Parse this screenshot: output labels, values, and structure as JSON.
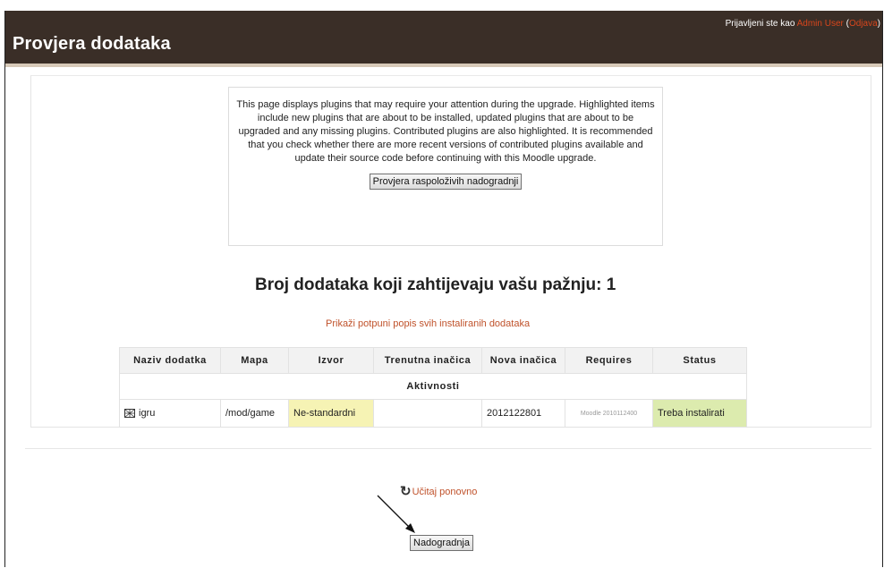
{
  "header": {
    "title": "Provjera dodataka",
    "login_prefix": "Prijavljeni ste kao ",
    "user_name": "Admin User",
    "logout_open": " (",
    "logout_label": "Odjava",
    "logout_close": ")"
  },
  "notice": {
    "text": "This page displays plugins that may require your attention during the upgrade. Highlighted items include new plugins that are about to be installed, updated plugins that are about to be upgraded and any missing plugins. Contributed plugins are also highlighted. It is recommended that you check whether there are more recent versions of contributed plugins available and update their source code before continuing with this Moodle upgrade.",
    "check_button": "Provjera raspoloživih nadogradnji"
  },
  "count_heading": "Broj dodataka koji zahtijevaju vašu pažnju: 1",
  "show_all_link": "Prikaži potpuni popis svih instaliranih dodataka",
  "table": {
    "headers": [
      "Naziv dodatka",
      "Mapa",
      "Izvor",
      "Trenutna inačica",
      "Nova inačica",
      "Requires",
      "Status"
    ],
    "group": "Aktivnosti",
    "rows": [
      {
        "icon": "game-plugin-icon",
        "name": "igru",
        "dir": "/mod/game",
        "source": "Ne-standardni",
        "current_version": "",
        "new_version": "2012122801",
        "requires": "Moodle 2010112400",
        "status": "Treba instalirati"
      }
    ]
  },
  "reload_link": "Učitaj ponovno",
  "upgrade_button": "Nadogradnja",
  "colors": {
    "header_bg": "#3a2e27",
    "link": "#c0522b",
    "nonstandard_bg": "#f6f3b4",
    "install_bg": "#dcebae"
  }
}
